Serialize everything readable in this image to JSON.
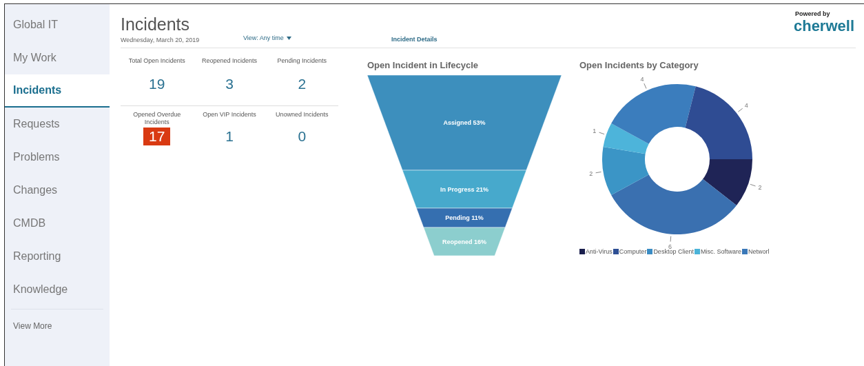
{
  "sidebar": {
    "items": [
      {
        "label": "Global IT",
        "selected": false
      },
      {
        "label": "My Work",
        "selected": false
      },
      {
        "label": "Incidents",
        "selected": true
      },
      {
        "label": "Requests",
        "selected": false
      },
      {
        "label": "Problems",
        "selected": false
      },
      {
        "label": "Changes",
        "selected": false
      },
      {
        "label": "CMDB",
        "selected": false
      },
      {
        "label": "Reporting",
        "selected": false
      },
      {
        "label": "Knowledge",
        "selected": false
      }
    ],
    "more": "View More"
  },
  "header": {
    "title": "Incidents",
    "date": "Wednesday, March 20, 2019",
    "view": "View: Any time",
    "details_link": "Incident Details",
    "powered_by": "Powered by",
    "brand": "cherwell"
  },
  "stats": [
    {
      "label": "Total Open Incidents",
      "value": "19",
      "alert": false
    },
    {
      "label": "Reopened Incidents",
      "value": "3",
      "alert": false
    },
    {
      "label": "Pending Incidents",
      "value": "2",
      "alert": false
    },
    {
      "label": "Opened Overdue Incidents",
      "value": "17",
      "alert": true
    },
    {
      "label": "Open VIP Incidents",
      "value": "1",
      "alert": false
    },
    {
      "label": "Unowned Incidents",
      "value": "0",
      "alert": false
    }
  ],
  "funnel": {
    "title": "Open Incident in Lifecycle",
    "segments": [
      {
        "label": "Assigned 53%",
        "color": "#3d8fbd"
      },
      {
        "label": "In Progress 21%",
        "color": "#47a9cc"
      },
      {
        "label": "Pending 11%",
        "color": "#356fb0"
      },
      {
        "label": "Reopened 16%",
        "color": "#8ccece"
      }
    ]
  },
  "donut": {
    "title": "Open Incidents by Category",
    "slices": [
      {
        "value": "2",
        "color": "#1f2456"
      },
      {
        "value": "6",
        "color": "#3a70b0"
      },
      {
        "value": "2",
        "color": "#3b95c6"
      },
      {
        "value": "1",
        "color": "#4db4da"
      },
      {
        "value": "4",
        "color": "#3b7dbd"
      },
      {
        "value": "4",
        "color": "#2f4c93"
      }
    ],
    "legend": [
      {
        "label": "Anti-Virus",
        "color": "#1a1f4d"
      },
      {
        "label": "Computer",
        "color": "#2e4f94"
      },
      {
        "label": "Desktop Client",
        "color": "#3a8cc4"
      },
      {
        "label": "Misc. Software",
        "color": "#4bb3d8"
      },
      {
        "label": "Networl",
        "color": "#3a78b8"
      }
    ]
  }
}
